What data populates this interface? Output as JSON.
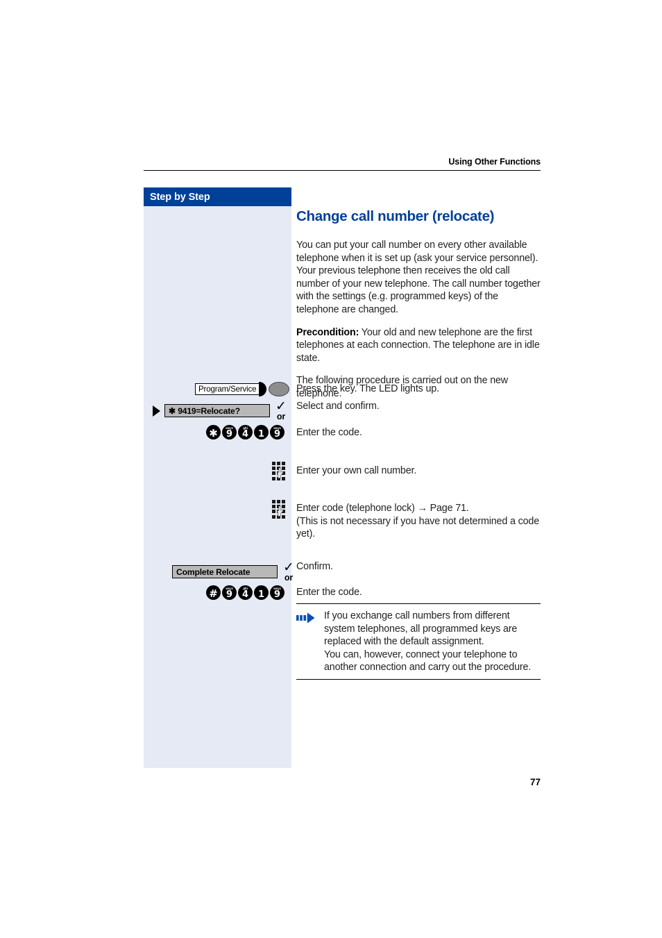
{
  "header": {
    "running_title": "Using Other Functions"
  },
  "sidebar": {
    "title": "Step by Step"
  },
  "content": {
    "chapter_title": "Change call number (relocate)",
    "paragraph_1": "You can put your call number on every other available telephone when it is set up (ask your service personnel). Your previous telephone then receives the old call number of your new telephone. The call number together with the settings (e.g. programmed keys) of the telephone are changed.",
    "precondition_label": "Precondition:",
    "precondition_text": " Your old and new telephone are the first telephones at each connection. The telephone are in idle state.",
    "paragraph_2": "The following procedure is carried out on the new telephone."
  },
  "steps": [
    {
      "id": "program-service",
      "key_label": "Program/Service",
      "description": "Press the key. The LED lights up."
    },
    {
      "id": "select-relocate",
      "option_label": "✱ 9419=Relocate?",
      "or_label": "or",
      "description": "Select and confirm."
    },
    {
      "id": "enter-code-star",
      "description": "Enter the code.",
      "keys": [
        {
          "digit": "✱",
          "alpha": ""
        },
        {
          "digit": "9",
          "alpha": "wxyz"
        },
        {
          "digit": "4",
          "alpha": "ghi"
        },
        {
          "digit": "1",
          "alpha": ""
        },
        {
          "digit": "9",
          "alpha": "wxyz"
        }
      ]
    },
    {
      "id": "enter-own-number",
      "icon": "keypad-icon",
      "description": "Enter your own call number."
    },
    {
      "id": "enter-telephone-lock-code",
      "icon": "keypad-icon",
      "description": "Enter code (telephone lock) → Page 71.\n(This is not necessary if you have not determined a code yet)."
    },
    {
      "id": "complete-relocate",
      "option_label": "Complete Relocate",
      "or_label": "or",
      "description": "Confirm."
    },
    {
      "id": "enter-code-hash",
      "description": "Enter the code.",
      "keys": [
        {
          "digit": "#",
          "alpha": ""
        },
        {
          "digit": "9",
          "alpha": "wxyz"
        },
        {
          "digit": "4",
          "alpha": "ghi"
        },
        {
          "digit": "1",
          "alpha": ""
        },
        {
          "digit": "9",
          "alpha": "wxyz"
        }
      ]
    }
  ],
  "note": {
    "icon": "blue-arrow-icon",
    "text": "If you exchange call numbers from different system telephones, all programmed keys are replaced with the default assignment.\nYou can, however, connect your telephone to another connection and carry out the procedure."
  },
  "footer": {
    "page_number": "77"
  },
  "colors": {
    "brand_blue": "#004099",
    "sidebar_bg": "#e5eaf5",
    "option_box_gray": "#b8b8b8",
    "note_arrow_blue": "#0b4fb4"
  }
}
